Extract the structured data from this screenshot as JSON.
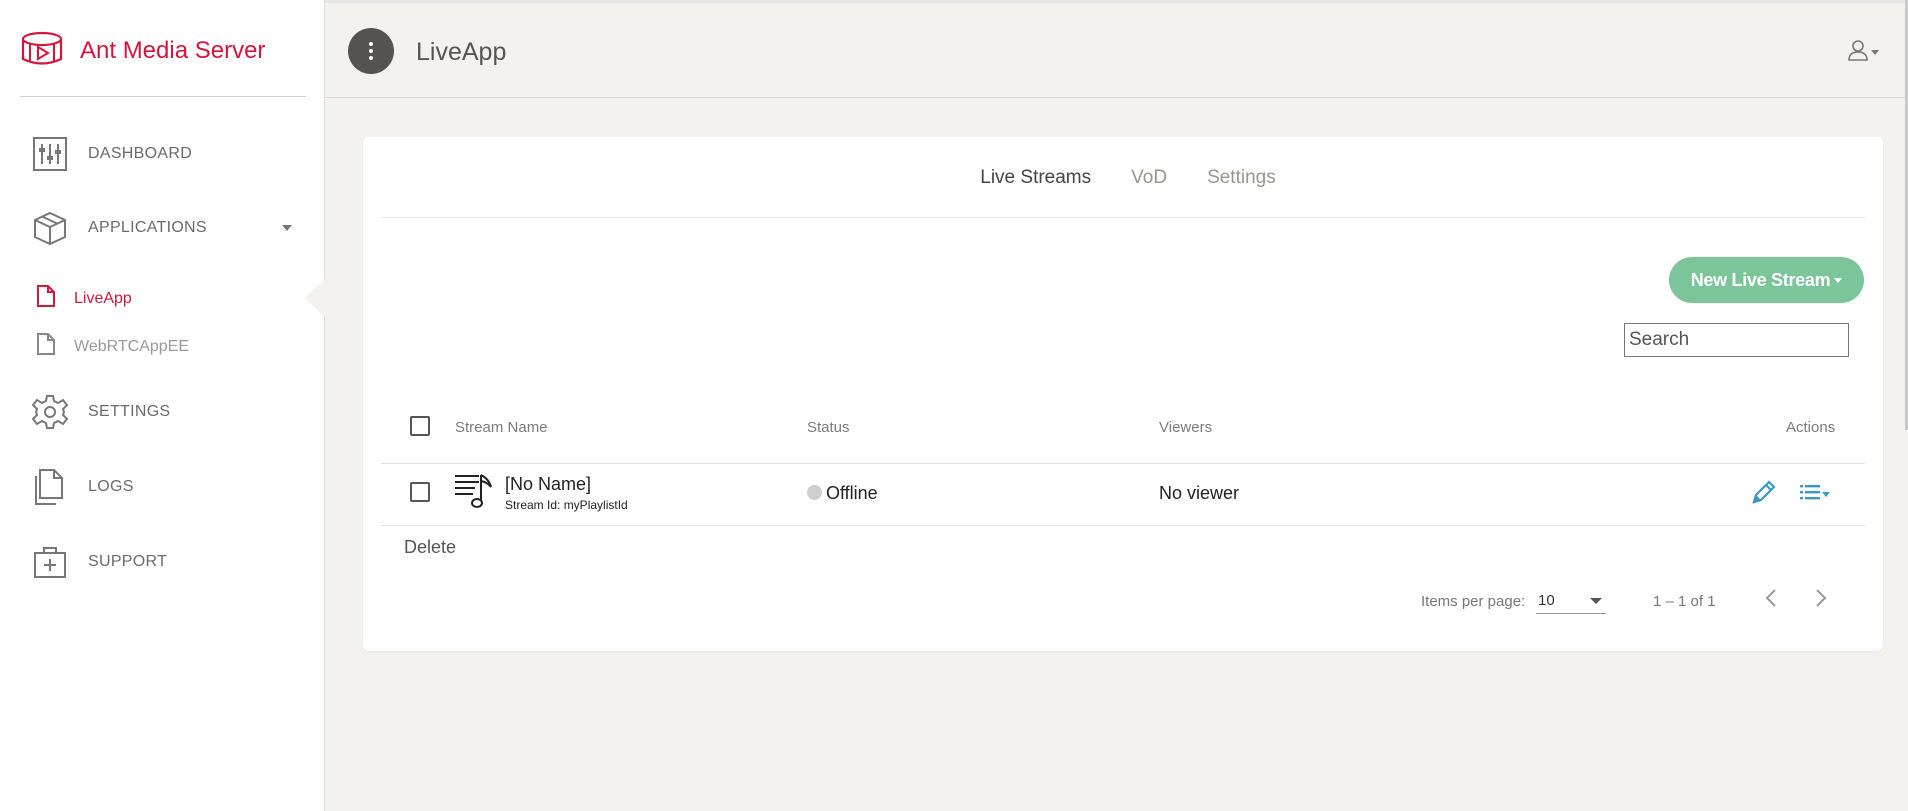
{
  "brand": {
    "title": "Ant Media Server",
    "color": "#d4163c"
  },
  "sidebar": {
    "items": [
      {
        "label": "DASHBOARD",
        "icon": "sliders-icon"
      },
      {
        "label": "APPLICATIONS",
        "icon": "cube-icon"
      },
      {
        "label": "SETTINGS",
        "icon": "gear-icon"
      },
      {
        "label": "LOGS",
        "icon": "files-icon"
      },
      {
        "label": "SUPPORT",
        "icon": "first-aid-kit-icon"
      }
    ],
    "apps": [
      {
        "label": "LiveApp",
        "icon": "file-icon",
        "active": true
      },
      {
        "label": "WebRTCAppEE",
        "icon": "file-icon",
        "active": false
      }
    ]
  },
  "header": {
    "title": "LiveApp"
  },
  "tabs": [
    {
      "label": "Live Streams",
      "active": true
    },
    {
      "label": "VoD",
      "active": false
    },
    {
      "label": "Settings",
      "active": false
    }
  ],
  "toolbar": {
    "new_stream_label": "New Live Stream",
    "search_placeholder": "Search",
    "accent": "#7cc49a"
  },
  "table": {
    "columns": [
      "Stream Name",
      "Status",
      "Viewers",
      "Actions"
    ],
    "rows": [
      {
        "name": "[No Name]",
        "stream_id": "Stream Id: myPlaylistId",
        "status": "Offline",
        "viewers": "No viewer"
      }
    ]
  },
  "delete_label": "Delete",
  "pagination": {
    "items_per_page_label": "Items per page:",
    "items_per_page": "10",
    "range": "1 – 1 of 1"
  }
}
